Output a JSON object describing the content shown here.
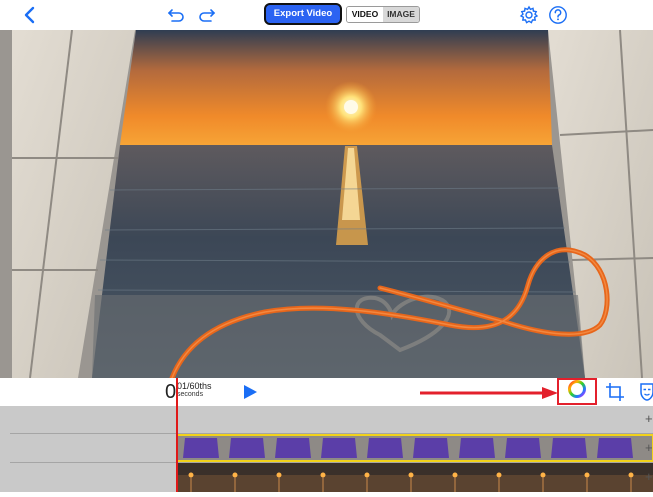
{
  "toolbar": {
    "export_label": "Export Video",
    "mode_options": [
      "VIDEO",
      "IMAGE"
    ],
    "mode_selected": "VIDEO"
  },
  "transport": {
    "time_whole": "0",
    "time_fraction": "01/60ths",
    "time_unit": "seconds"
  },
  "timeline": {
    "add_symbol": "+"
  },
  "colors": {
    "accent": "#2b63f2",
    "highlight": "#e3202c",
    "playhead": "#e01919",
    "clip_purple": "#5b3ea8",
    "clip_border": "#f2d21a"
  },
  "icons": [
    "chevron-left-icon",
    "undo-icon",
    "redo-icon",
    "gear-icon",
    "help-icon",
    "play-icon",
    "color-wheel-icon",
    "crop-icon",
    "mask-icon",
    "arrow-right-icon"
  ]
}
